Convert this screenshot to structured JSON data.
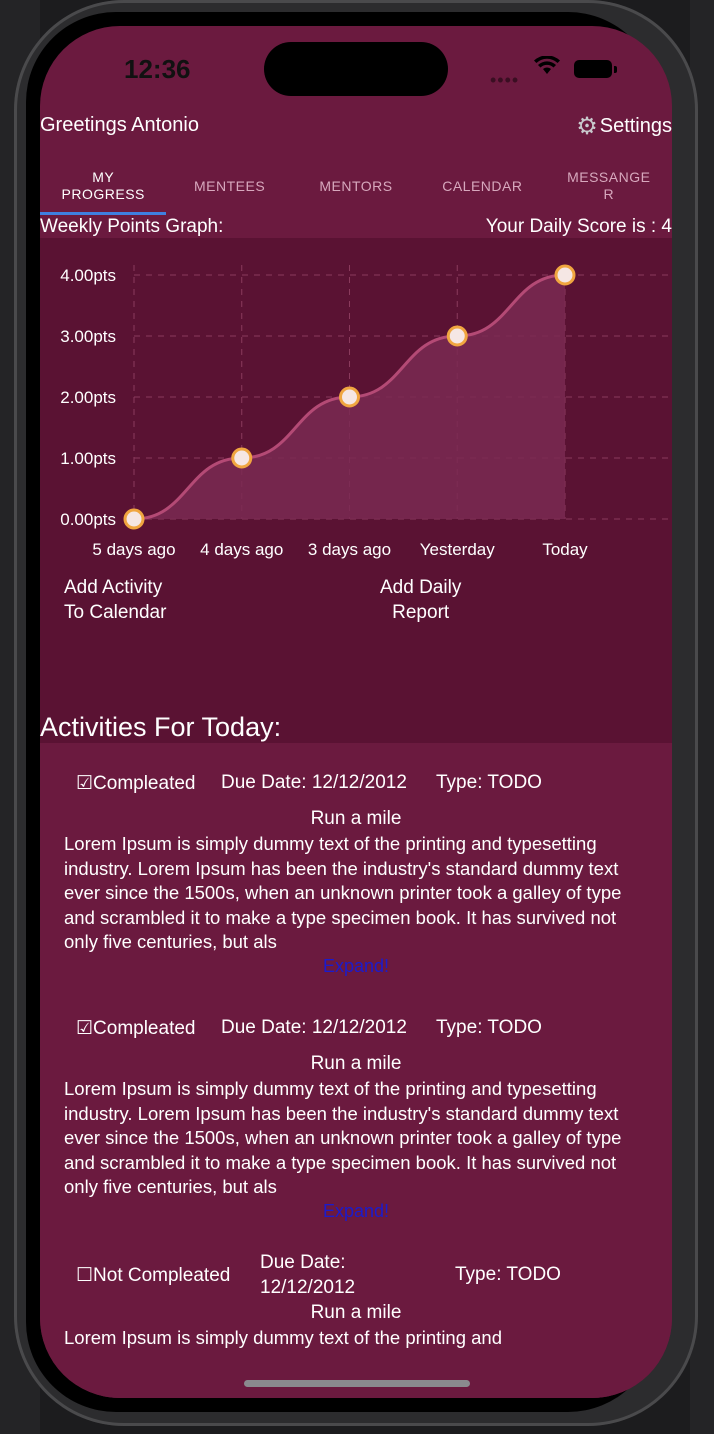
{
  "status_bar": {
    "time": "12:36"
  },
  "header": {
    "greeting": "Greetings Antonio",
    "settings_label": "Settings"
  },
  "tabs": [
    {
      "label": "MY\nPROGRESS",
      "active": true
    },
    {
      "label": "MENTEES",
      "active": false
    },
    {
      "label": "MENTORS",
      "active": false
    },
    {
      "label": "CALENDAR",
      "active": false
    },
    {
      "label": "MESSANGE\nR",
      "active": false
    }
  ],
  "graph": {
    "title": "Weekly Points Graph:",
    "daily_score": "Your Daily Score is : 4"
  },
  "chart_data": {
    "type": "area",
    "categories": [
      "5 days ago",
      "4 days ago",
      "3 days ago",
      "Yesterday",
      "Today"
    ],
    "values": [
      0,
      1,
      2,
      3,
      4
    ],
    "y_ticks": [
      "0.00pts",
      "1.00pts",
      "2.00pts",
      "3.00pts",
      "4.00pts"
    ],
    "ylim": [
      0,
      4
    ],
    "grid": true,
    "colors": {
      "line": "#b44a75",
      "fill": "#7a2a52",
      "point_fill": "#f5e7e4",
      "point_stroke": "#f0a640",
      "grid": "#8a3a5c"
    }
  },
  "actions": {
    "add_activity_line1": "Add Activity",
    "add_activity_line2": "To Calendar",
    "add_report_line1": "Add Daily",
    "add_report_line2": "Report"
  },
  "activities": {
    "title": "Activities For Today:",
    "items": [
      {
        "status": "☑Compleated",
        "due": "Due Date: 12/12/2012",
        "type": "Type: TODO",
        "name": "Run a mile",
        "description": "Lorem Ipsum is simply dummy text of the printing and typesetting industry. Lorem Ipsum has been the industry's standard dummy text ever since the 1500s, when an unknown printer took a galley of type and scrambled it to make a type specimen book. It has survived not only five centuries, but als",
        "expand": "Expand!"
      },
      {
        "status": "☑Compleated",
        "due": "Due Date: 12/12/2012",
        "type": "Type: TODO",
        "name": "Run a mile",
        "description": "Lorem Ipsum is simply dummy text of the printing and typesetting industry. Lorem Ipsum has been the industry's standard dummy text ever since the 1500s, when an unknown printer took a galley of type and scrambled it to make a type specimen book. It has survived not only five centuries, but als",
        "expand": "Expand!"
      },
      {
        "status": "☐Not Compleated",
        "due_line1": "Due Date:",
        "due_line2": "12/12/2012",
        "type": "Type: TODO",
        "name": "Run a mile",
        "description": "Lorem Ipsum is simply dummy text of the printing and"
      }
    ]
  }
}
